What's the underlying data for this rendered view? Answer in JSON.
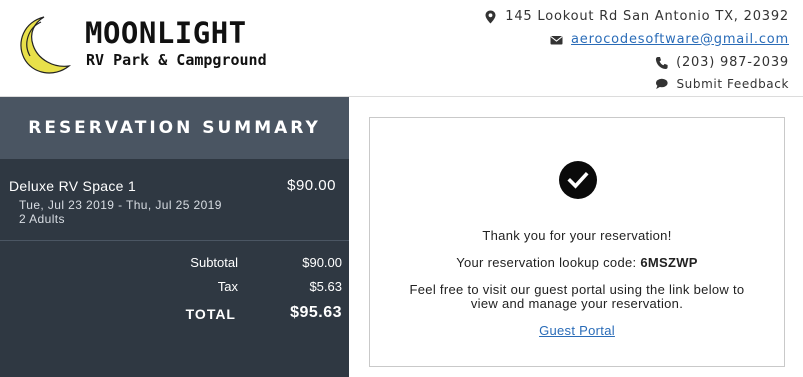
{
  "header": {
    "brand_name": "MOONLIGHT",
    "brand_subtitle": "RV Park & Campground",
    "logo_icon": "moon-logo",
    "address": "145 Lookout Rd San Antonio TX, 20392",
    "email": "aerocodesoftware@gmail.com",
    "phone": "(203) 987-2039",
    "feedback_label": "Submit Feedback",
    "icons": [
      "map-marker-icon",
      "envelope-icon",
      "phone-icon",
      "chat-bubble-icon"
    ]
  },
  "summary": {
    "title": "RESERVATION SUMMARY",
    "item": {
      "name": "Deluxe RV Space 1",
      "price": "$90.00",
      "dates": "Tue, Jul 23 2019 - Thu, Jul 25 2019",
      "guests": "2 Adults"
    },
    "subtotal_label": "Subtotal",
    "subtotal_value": "$90.00",
    "tax_label": "Tax",
    "tax_value": "$5.63",
    "total_label": "TOTAL",
    "total_value": "$95.63"
  },
  "confirmation": {
    "icon": "check-circle-icon",
    "thanks": "Thank you for your reservation!",
    "code_label": "Your reservation lookup code:",
    "code": "6MSZWP",
    "portal_text_1": "Feel free to visit our guest portal using the link below to",
    "portal_text_2": "view and manage your reservation.",
    "portal_link": "Guest Portal"
  },
  "colors": {
    "summary_bg": "#2f3842",
    "summary_head_bg": "#4a5562",
    "moon_yellow": "#e8e04a",
    "link_blue": "#2a6cb8"
  }
}
